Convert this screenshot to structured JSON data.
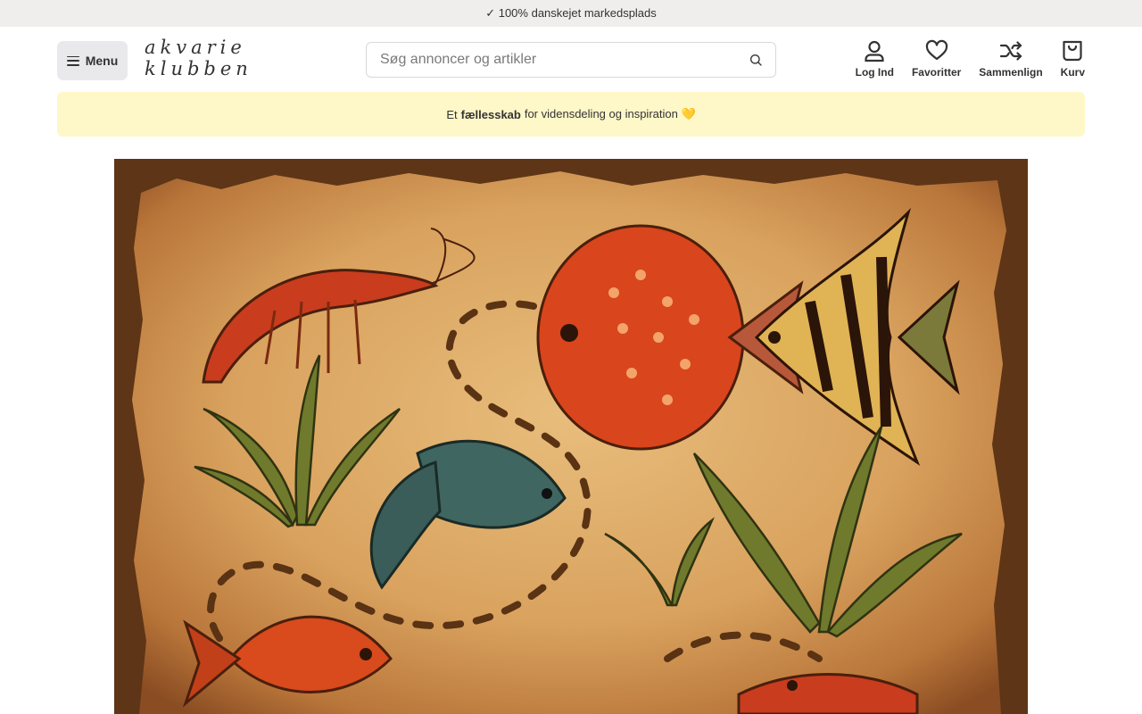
{
  "topbar": {
    "text": "✓ 100% danskejet markedsplads"
  },
  "header": {
    "menu_label": "Menu",
    "logo_line1": "akvarie",
    "logo_line2": "klubben",
    "search_placeholder": "Søg annoncer og artikler",
    "actions": [
      {
        "label": "Log Ind",
        "icon": "user-icon"
      },
      {
        "label": "Favoritter",
        "icon": "heart-icon"
      },
      {
        "label": "Sammenlign",
        "icon": "shuffle-icon"
      },
      {
        "label": "Kurv",
        "icon": "shopping-bag-icon"
      }
    ]
  },
  "promo": {
    "prefix": "Et",
    "bold": "fællesskab",
    "suffix": "for vidensdeling og inspiration 💛"
  },
  "colors": {
    "topbar_bg": "#efeeec",
    "promo_bg": "#fef7c8",
    "menu_bg": "#e9e9eb",
    "parchment": "#d9a25e"
  }
}
